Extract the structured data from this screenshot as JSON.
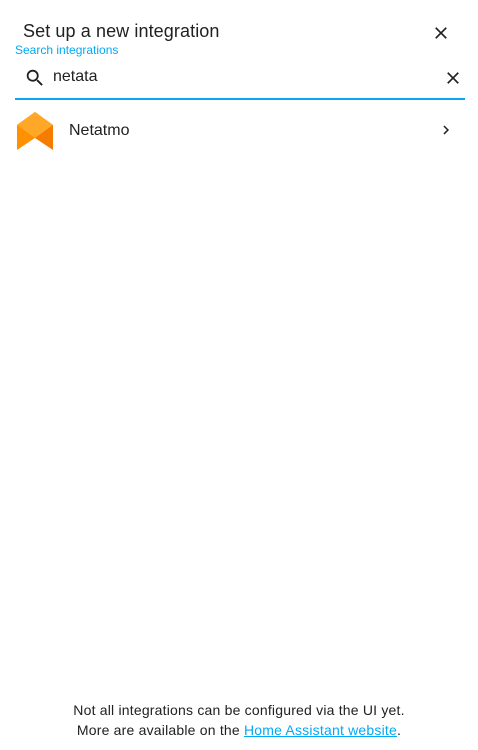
{
  "dialog": {
    "title": "Set up a new integration",
    "close_icon": "close-icon"
  },
  "search": {
    "label": "Search integrations",
    "value": "netata",
    "icon": "search-icon",
    "clear_icon": "clear-icon"
  },
  "results": [
    {
      "name": "Netatmo",
      "logo": "netatmo-logo",
      "chevron_icon": "chevron-right-icon"
    }
  ],
  "footer": {
    "line1": "Not all integrations can be configured via the UI yet.",
    "line2_prefix": "More are available on the ",
    "link_text": "Home Assistant website",
    "line2_suffix": "."
  },
  "colors": {
    "accent": "#03a9f4",
    "text": "#212121",
    "logo_orange": "#ff9100",
    "logo_dark_orange": "#f57c00"
  }
}
